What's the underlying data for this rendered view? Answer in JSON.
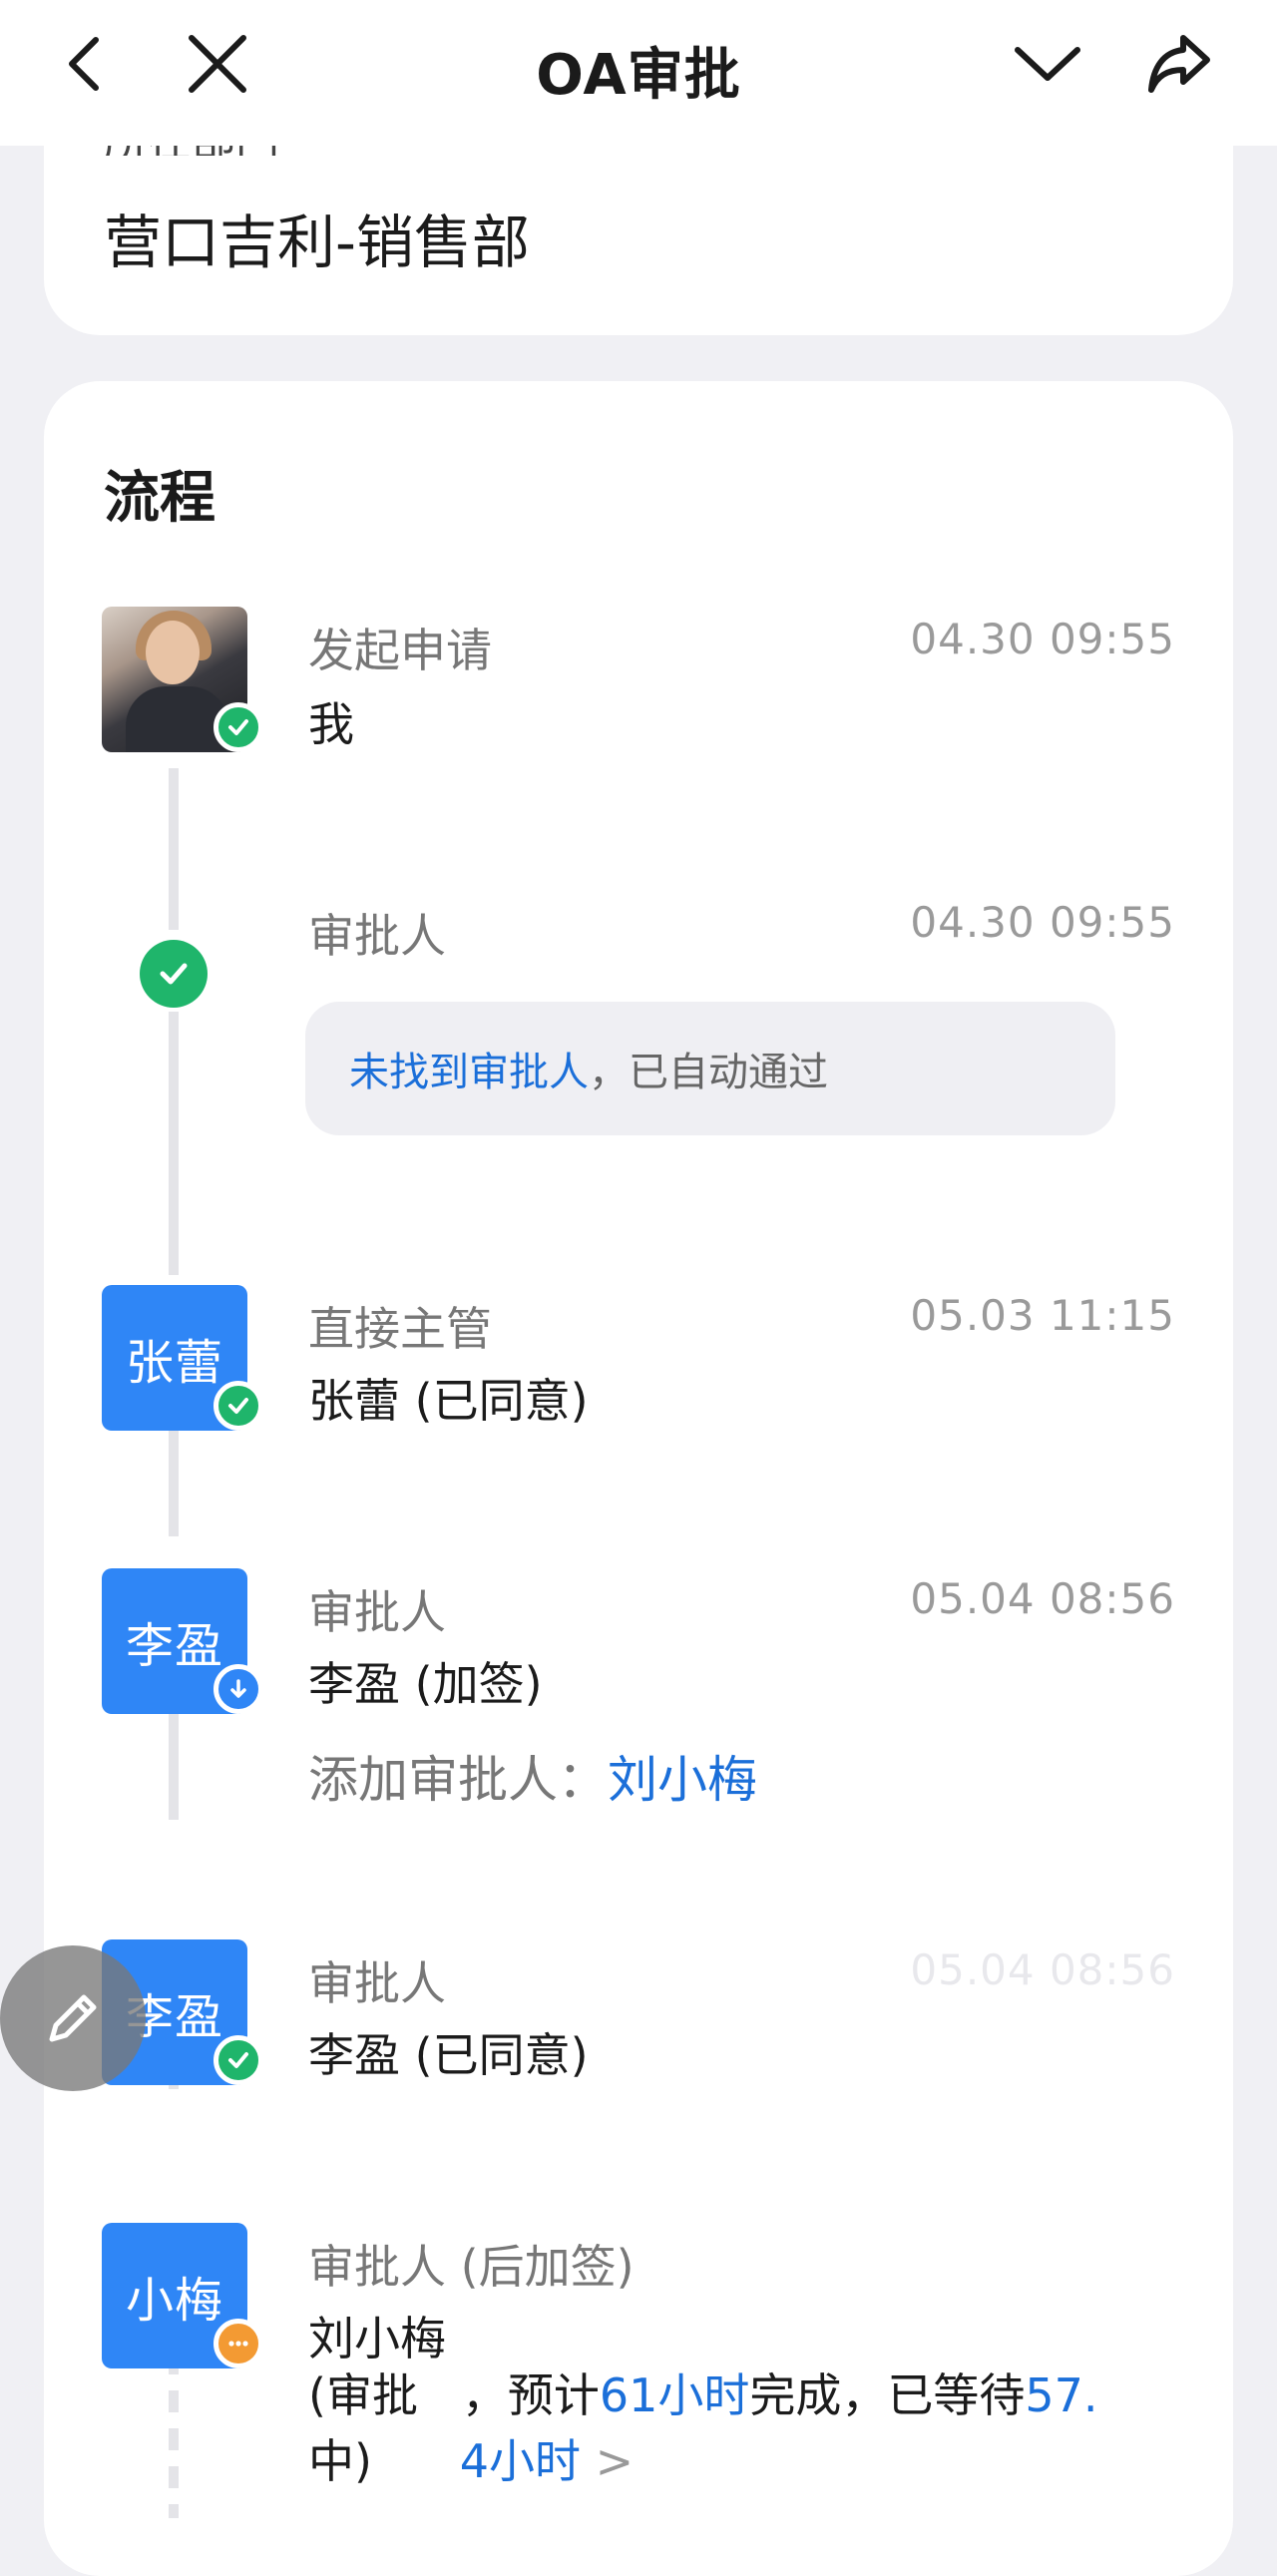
{
  "header": {
    "title": "OA审批"
  },
  "department": {
    "label": "所在部门",
    "value": "营口吉利-销售部"
  },
  "process": {
    "title": "流程",
    "steps": [
      {
        "label": "发起申请",
        "name": "我",
        "time": "04.30 09:55",
        "status": "approved"
      },
      {
        "label": "审批人",
        "time": "04.30 09:55",
        "notice_link": "未找到审批人",
        "notice_text": "，已自动通过",
        "status": "approved"
      },
      {
        "avatar": "张蕾",
        "label": "直接主管",
        "name": "张蕾 (已同意)",
        "time": "05.03 11:15",
        "status": "approved"
      },
      {
        "avatar": "李盈",
        "label": "审批人",
        "name": "李盈 (加签)",
        "time": "05.04 08:56",
        "add_label": "添加审批人：",
        "add_name": "刘小梅",
        "status": "add-sign"
      },
      {
        "avatar": "李盈",
        "label": "审批人",
        "name": "李盈 (已同意)",
        "time": "05.04 08:56",
        "status": "approved"
      },
      {
        "avatar": "小梅",
        "label": "审批人 (后加签)",
        "name": "刘小梅",
        "line1_pre": "(审批   ，预计",
        "line1_link": "61小时",
        "line1_mid": "完成，已等待",
        "line1_link2": "57.",
        "line2_pre": "中)      ",
        "line2_link": "4小时",
        "line2_chevron": ">",
        "status": "pending"
      }
    ]
  },
  "colors": {
    "accent": "#2f86f6",
    "link": "#1b6fd9",
    "success": "#1fb56b",
    "pending": "#f39a33"
  }
}
